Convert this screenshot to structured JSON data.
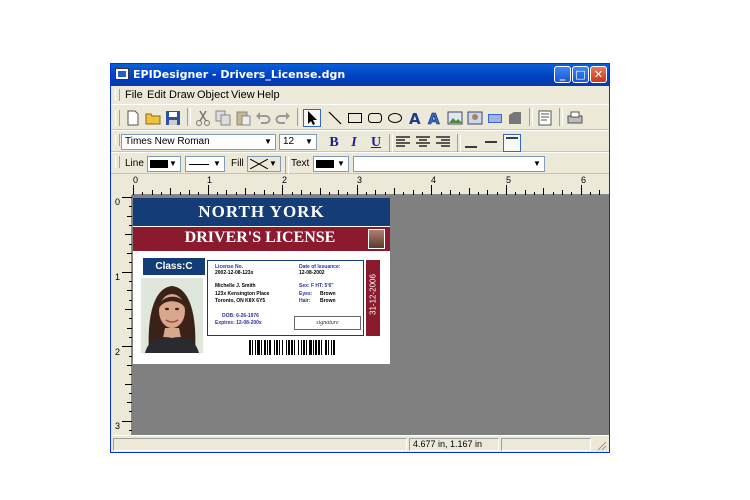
{
  "window": {
    "title": "EPIDesigner - Drivers_License.dgn",
    "minimize": "_",
    "maximize": "□",
    "close": "✕"
  },
  "menu": [
    "File",
    "Edit",
    "Draw",
    "Object",
    "View",
    "Help"
  ],
  "toolbar": {
    "icons": [
      "new-file-icon",
      "open-folder-icon",
      "save-icon",
      "cut-icon",
      "copy-icon",
      "paste-icon",
      "undo-icon",
      "redo-icon",
      "select-arrow-icon",
      "line-tool-icon",
      "rectangle-tool-icon",
      "rounded-rectangle-tool-icon",
      "ellipse-tool-icon",
      "text-tool-icon",
      "art-text-icon",
      "image-tool-icon",
      "picture-tool-icon",
      "barcode-tool-icon",
      "shape-tool-icon",
      "properties-icon",
      "print-icon"
    ]
  },
  "format": {
    "font": "Times New Roman",
    "size": "12",
    "bold": "B",
    "italic": "I",
    "underline": "U"
  },
  "props": {
    "line_label": "Line",
    "fill_label": "Fill",
    "text_label": "Text"
  },
  "ruler": {
    "top_numbers": [
      "0",
      "1",
      "2",
      "3",
      "4",
      "5",
      "6"
    ],
    "left_numbers": [
      "0",
      "1",
      "2",
      "3"
    ]
  },
  "card": {
    "header": "NORTH YORK",
    "band": "DRIVER'S LICENSE",
    "class": "Class:C",
    "license_no_label": "License No.",
    "license_no": "2002-12-08-123x",
    "date_issuance_label": "Date of Issuance:",
    "date_issuance": "12-08-2002",
    "name": "Michelle J. Smith",
    "address1": "123x Kensington Place",
    "address2": "Toronto, ON K8X 6Y5",
    "sex_ht": "Sex: F  HT: 5'6\"",
    "eyes_label": "Eyes:",
    "eyes": "Brown",
    "hair_label": "Hair:",
    "hair": "Brown",
    "dob": "DOB: 6-26-1976",
    "expires": "Expires: 12-08-200x",
    "vertical_date": "31-12-2006",
    "signature": "signature"
  },
  "status": {
    "coords": "4.677 in, 1.167 in",
    "pane1": "",
    "pane3": ""
  },
  "colors": {
    "header_blue": "#143d78",
    "band_red": "#8c1a2e",
    "canvas_gray": "#808080"
  }
}
